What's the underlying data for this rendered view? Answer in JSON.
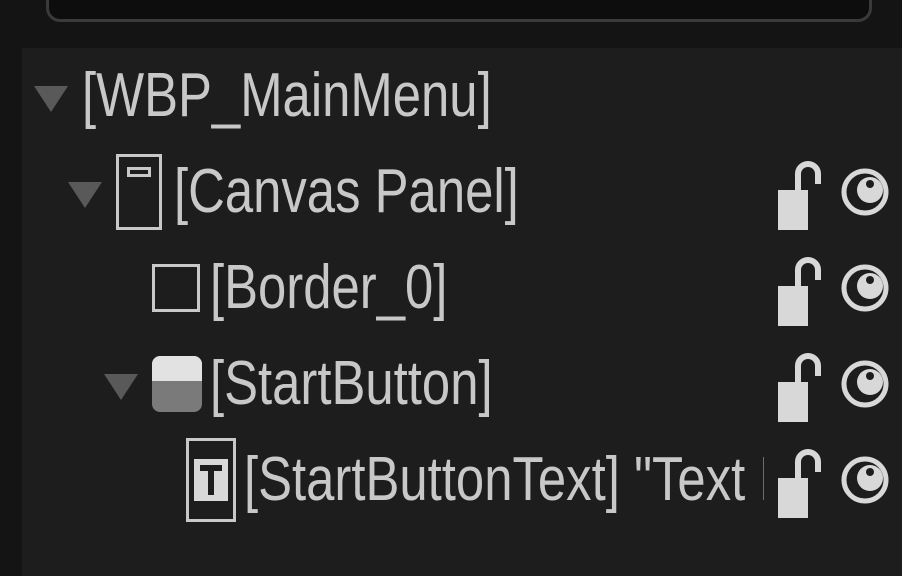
{
  "hierarchy": {
    "items": [
      {
        "label": "[WBP_MainMenu]",
        "icon": "none",
        "expanded": true
      },
      {
        "label": "[Canvas Panel]",
        "icon": "canvas-panel-icon",
        "expanded": true
      },
      {
        "label": "[Border_0]",
        "icon": "border-icon",
        "expanded": false
      },
      {
        "label": "[StartButton]",
        "icon": "button-icon",
        "expanded": true
      },
      {
        "label": "[StartButtonText] \"Text Block\"",
        "icon": "text-block-icon",
        "expanded": false
      }
    ]
  },
  "colors": {
    "panel_bg": "#1d1d1d",
    "text": "#c8c8c8",
    "arrow": "#595959",
    "icon": "#d8d8d8"
  }
}
